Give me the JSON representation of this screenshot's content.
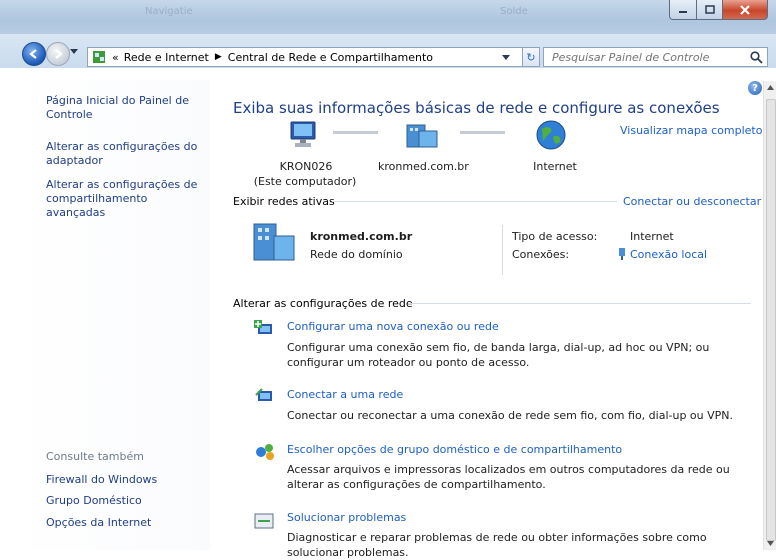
{
  "window": {
    "ghost_left": "Navigatie",
    "ghost_right": "Solde"
  },
  "address": {
    "chevrons": "«",
    "crumbs": [
      "Rede e Internet",
      "Central de Rede e Compartilhamento"
    ],
    "search_placeholder": "Pesquisar Painel de Controle"
  },
  "sidebar": {
    "items": [
      {
        "label": "Página Inicial do Painel de Controle"
      },
      {
        "label": "Alterar as configurações do adaptador"
      },
      {
        "label": "Alterar as configurações de compartilhamento avançadas"
      }
    ],
    "see_also_title": "Consulte também",
    "see_also": [
      {
        "label": "Firewall do Windows"
      },
      {
        "label": "Grupo Doméstico"
      },
      {
        "label": "Opções da Internet"
      }
    ]
  },
  "main": {
    "heading": "Exiba suas informações básicas de rede e configure as conexões",
    "map_link": "Visualizar mapa completo",
    "nodes": {
      "computer_name": "KRON026",
      "computer_sub": "(Este computador)",
      "domain": "kronmed.com.br",
      "internet": "Internet"
    },
    "active_label": "Exibir redes ativas",
    "connect_link": "Conectar ou desconectar",
    "network": {
      "name": "kronmed.com.br",
      "type": "Rede do domínio",
      "access_label": "Tipo de acesso:",
      "access_value": "Internet",
      "connections_label": "Conexões:",
      "connections_value": "Conexão local"
    },
    "change_label": "Alterar as configurações de rede",
    "tasks": [
      {
        "title": "Configurar uma nova conexão ou rede",
        "desc": "Configurar uma conexão sem fio, de banda larga, dial-up, ad hoc ou VPN; ou configurar um roteador ou ponto de acesso."
      },
      {
        "title": "Conectar a uma rede",
        "desc": "Conectar ou reconectar a uma conexão de rede sem fio, com fio, dial-up ou VPN."
      },
      {
        "title": "Escolher opções de grupo doméstico e de compartilhamento",
        "desc": "Acessar arquivos e impressoras localizados em outros computadores da rede ou alterar as configurações de compartilhamento."
      },
      {
        "title": "Solucionar problemas",
        "desc": "Diagnosticar e reparar problemas de rede ou obter informações sobre como solucionar problemas."
      }
    ]
  }
}
